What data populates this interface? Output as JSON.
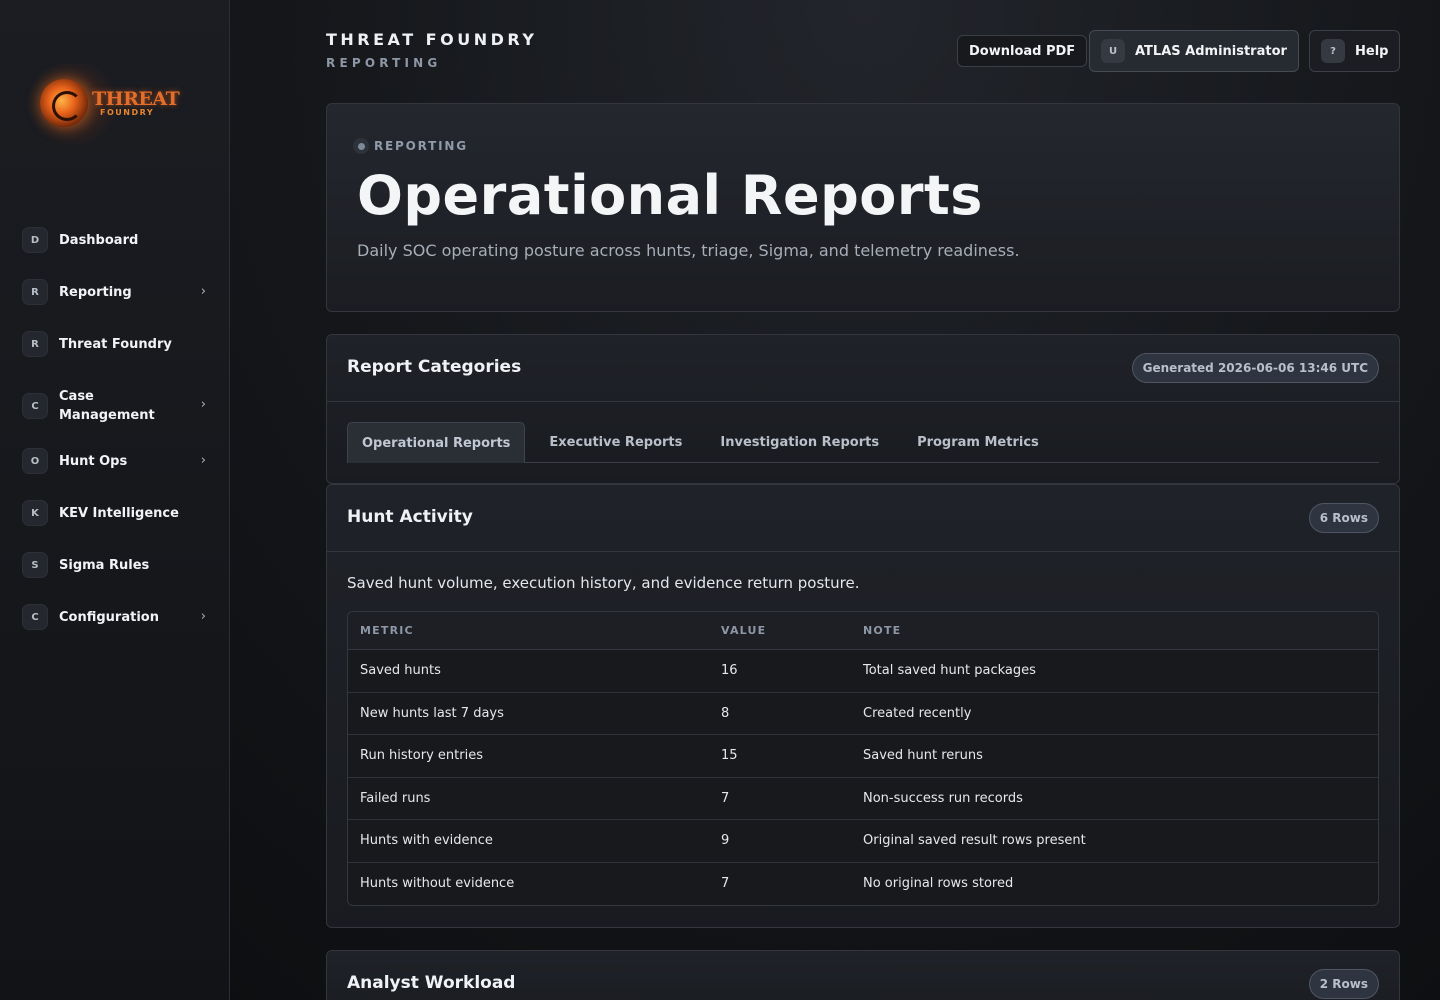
{
  "sidebar": {
    "logo": {
      "word": "THREAT",
      "sub": "FOUNDRY"
    },
    "items": [
      {
        "badge": "D",
        "label": "Dashboard",
        "chevron": false
      },
      {
        "badge": "R",
        "label": "Reporting",
        "chevron": true
      },
      {
        "badge": "R",
        "label": "Threat Foundry",
        "chevron": false
      },
      {
        "badge": "C",
        "label": "Case Management",
        "chevron": true
      },
      {
        "badge": "O",
        "label": "Hunt Ops",
        "chevron": true
      },
      {
        "badge": "K",
        "label": "KEV Intelligence",
        "chevron": false
      },
      {
        "badge": "S",
        "label": "Sigma Rules",
        "chevron": false
      },
      {
        "badge": "C",
        "label": "Configuration",
        "chevron": true
      }
    ],
    "chevron_glyph": "›"
  },
  "header": {
    "title": "THREAT FOUNDRY",
    "subtitle": "REPORTING",
    "download_label": "Download PDF",
    "user_badge": "U",
    "user_label": "ATLAS Administrator",
    "help_badge": "?",
    "help_label": "Help"
  },
  "hero": {
    "tag": "REPORTING",
    "title": "Operational Reports",
    "description": "Daily SOC operating posture across hunts, triage, Sigma, and telemetry readiness."
  },
  "categories": {
    "title": "Report Categories",
    "generated": "Generated 2026-06-06 13:46 UTC",
    "tabs": [
      "Operational Reports",
      "Executive Reports",
      "Investigation Reports",
      "Program Metrics"
    ],
    "active_tab": 0
  },
  "hunt_activity": {
    "title": "Hunt Activity",
    "row_count": "6 Rows",
    "description": "Saved hunt volume, execution history, and evidence return posture.",
    "columns": [
      "METRIC",
      "VALUE",
      "NOTE"
    ],
    "rows": [
      [
        "Saved hunts",
        "16",
        "Total saved hunt packages"
      ],
      [
        "New hunts last 7 days",
        "8",
        "Created recently"
      ],
      [
        "Run history entries",
        "15",
        "Saved hunt reruns"
      ],
      [
        "Failed runs",
        "7",
        "Non-success run records"
      ],
      [
        "Hunts with evidence",
        "9",
        "Original saved result rows present"
      ],
      [
        "Hunts without evidence",
        "7",
        "No original rows stored"
      ]
    ]
  },
  "analyst_workload": {
    "title": "Analyst Workload",
    "row_count": "2 Rows"
  }
}
